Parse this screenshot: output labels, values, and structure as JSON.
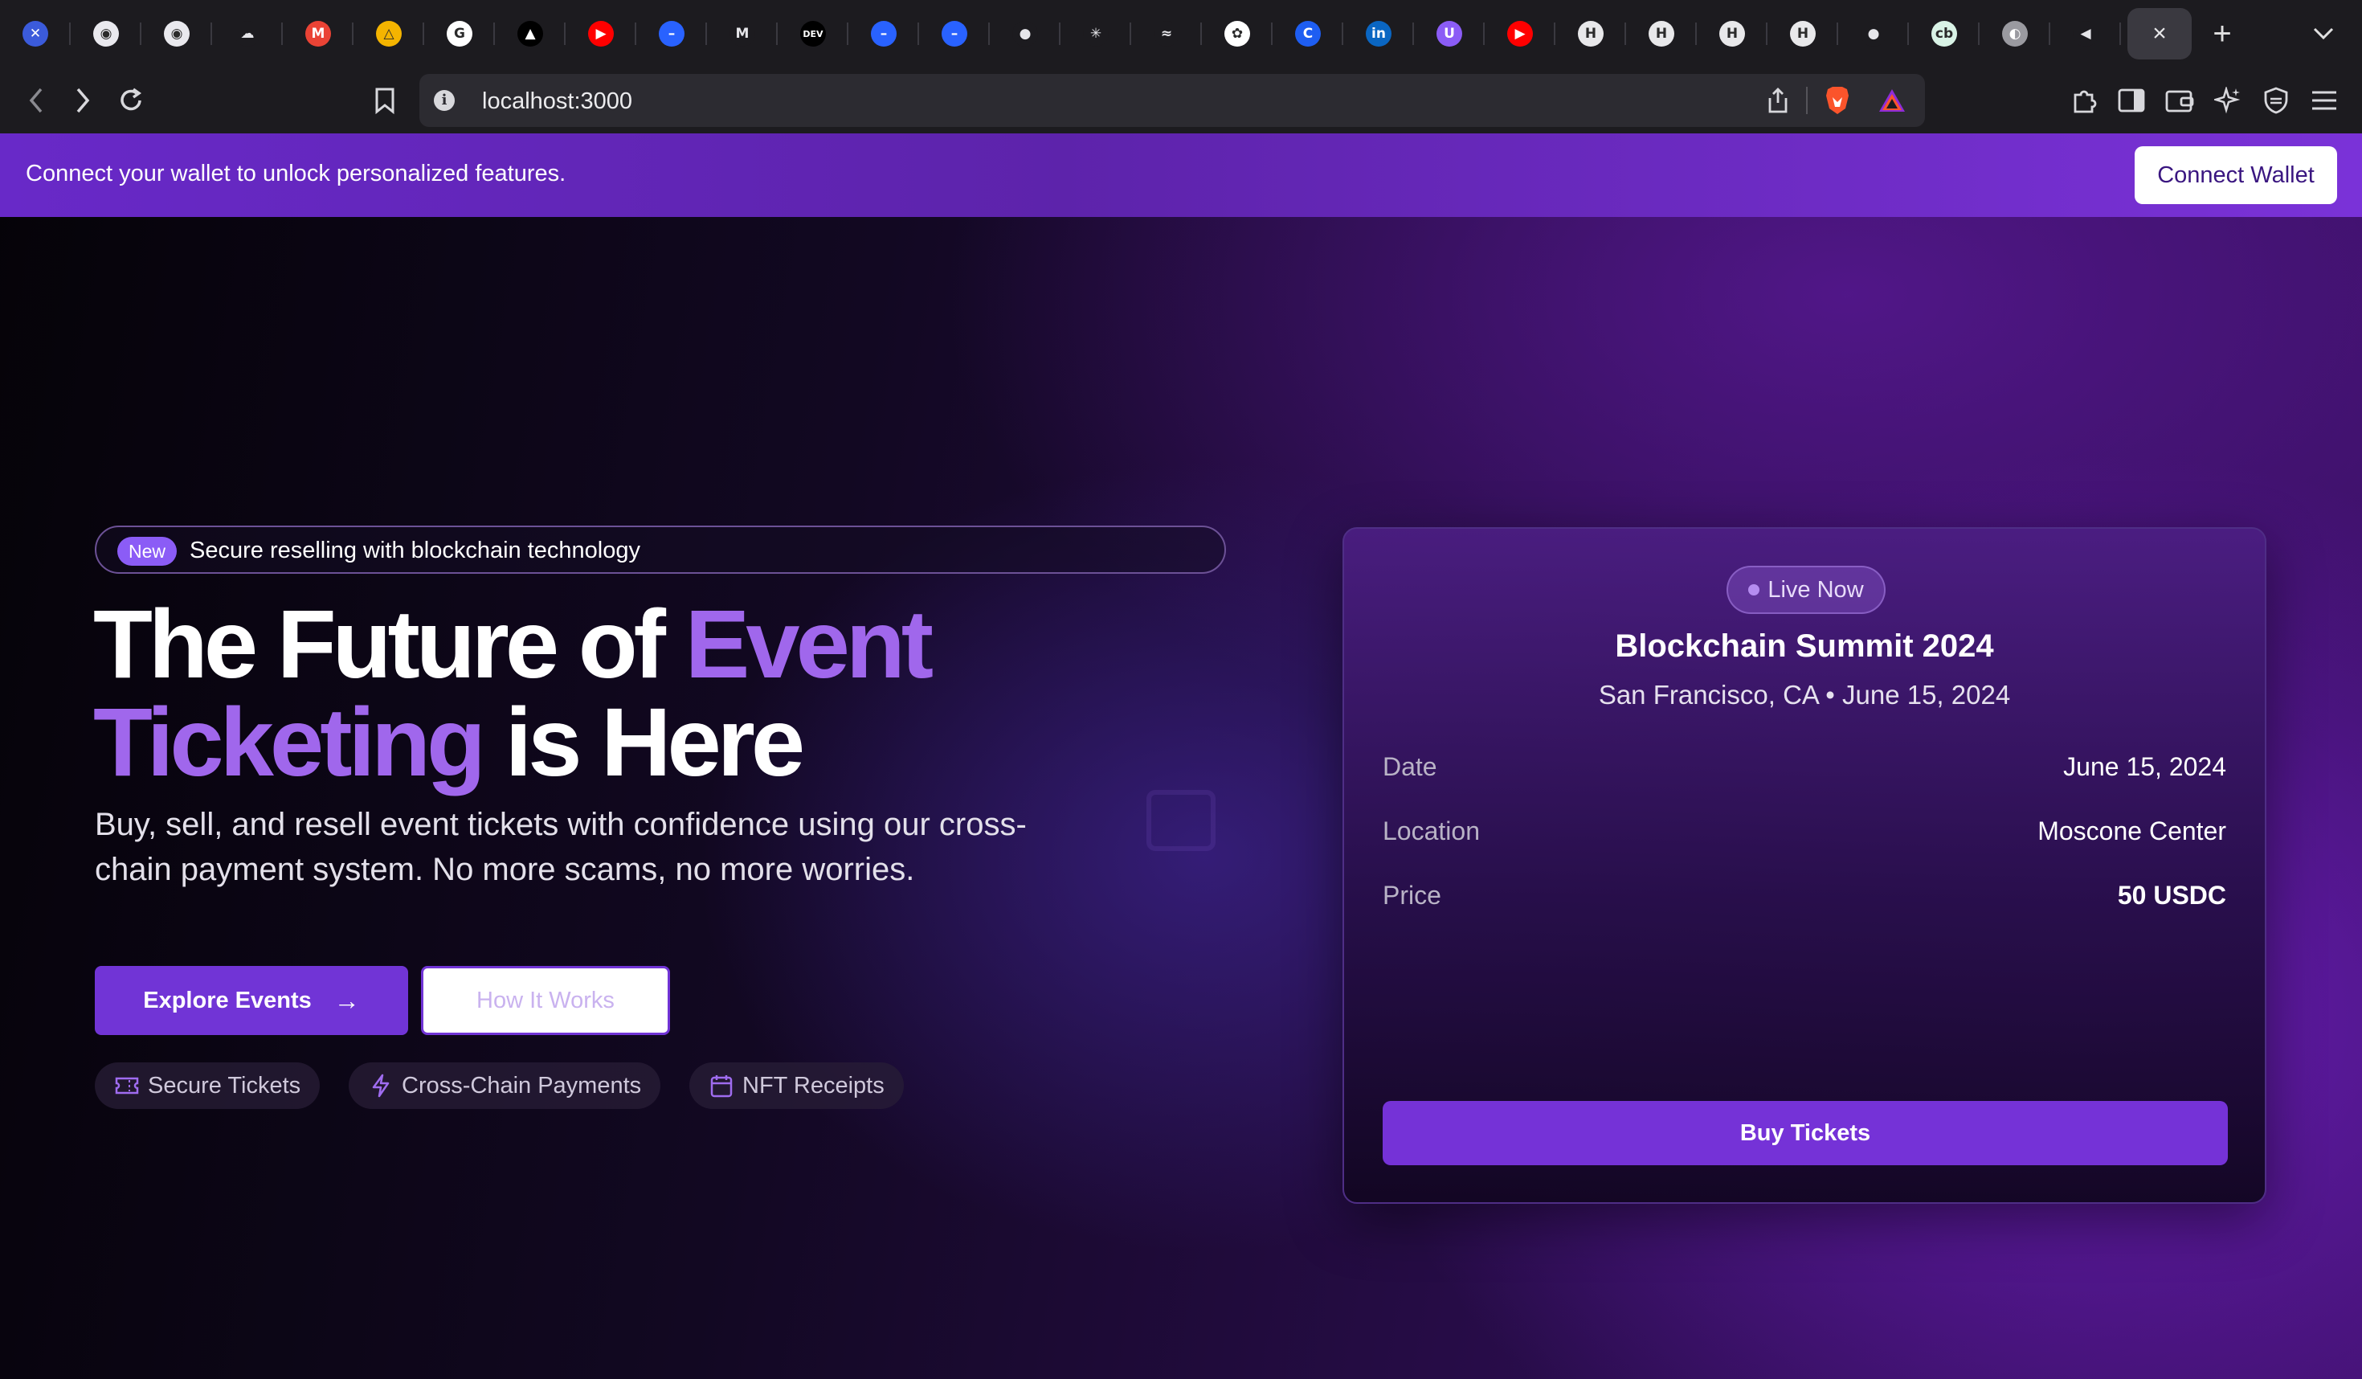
{
  "browser": {
    "tabs": [
      {
        "icon": "app-x-icon",
        "glyph": "✕",
        "color": "#3b5bdb"
      },
      {
        "icon": "circle-face-icon",
        "glyph": "◉",
        "color": "#e9e9ee"
      },
      {
        "icon": "circle-face-icon",
        "glyph": "◉",
        "color": "#e9e9ee"
      },
      {
        "icon": "cloud-icon",
        "glyph": "☁",
        "color": "#1c1b1f"
      },
      {
        "icon": "gmail-icon",
        "glyph": "M",
        "color": "#ea4335"
      },
      {
        "icon": "google-drive-icon",
        "glyph": "△",
        "color": "#f4b400"
      },
      {
        "icon": "google-icon",
        "glyph": "G",
        "color": "#ffffff"
      },
      {
        "icon": "triangle-icon",
        "glyph": "▲",
        "color": "#000000"
      },
      {
        "icon": "youtube-icon",
        "glyph": "▶",
        "color": "#ff0000"
      },
      {
        "icon": "blue-circle-icon",
        "glyph": "–",
        "color": "#2962ff"
      },
      {
        "icon": "mui-icon",
        "glyph": "M",
        "color": "#1c1b1f"
      },
      {
        "icon": "dev-icon",
        "glyph": "DEV",
        "color": "#000000"
      },
      {
        "icon": "blue-circle-icon",
        "glyph": "–",
        "color": "#2962ff"
      },
      {
        "icon": "blue-circle-icon",
        "glyph": "–",
        "color": "#2962ff"
      },
      {
        "icon": "github-icon",
        "glyph": "●",
        "color": "#1c1b1f"
      },
      {
        "icon": "asterisk-icon",
        "glyph": "✳",
        "color": "#1c1b1f"
      },
      {
        "icon": "tailwind-icon",
        "glyph": "≈",
        "color": "#1c1b1f"
      },
      {
        "icon": "openai-icon",
        "glyph": "✿",
        "color": "#ffffff"
      },
      {
        "icon": "c-icon",
        "glyph": "C",
        "color": "#1e5ef2"
      },
      {
        "icon": "linkedin-icon",
        "glyph": "in",
        "color": "#0a66c2"
      },
      {
        "icon": "u-icon",
        "glyph": "U",
        "color": "#8b5cf6"
      },
      {
        "icon": "youtube-icon",
        "glyph": "▶",
        "color": "#ff0000"
      },
      {
        "icon": "h-doc-icon",
        "glyph": "H",
        "color": "#e8e8ea"
      },
      {
        "icon": "h-doc-icon",
        "glyph": "H",
        "color": "#e8e8ea"
      },
      {
        "icon": "h-doc-icon",
        "glyph": "H",
        "color": "#e8e8ea"
      },
      {
        "icon": "h-doc-icon",
        "glyph": "H",
        "color": "#e8e8ea"
      },
      {
        "icon": "github-icon",
        "glyph": "●",
        "color": "#1c1b1f"
      },
      {
        "icon": "cb-icon",
        "glyph": "cb",
        "color": "#d9f3e6"
      },
      {
        "icon": "globe-icon",
        "glyph": "◐",
        "color": "#9a9aa0"
      },
      {
        "icon": "vscode-icon",
        "glyph": "◀",
        "color": "#1c1b1f"
      }
    ],
    "active_tab_close": "×",
    "new_tab": "+",
    "url": "localhost:3000"
  },
  "banner": {
    "text": "Connect your wallet to unlock personalized features.",
    "button": "Connect Wallet"
  },
  "hero": {
    "badge": "New",
    "badge_text": "Secure reselling with blockchain technology",
    "title_part1": "The Future of ",
    "title_accent": "Event Ticketing",
    "title_part2": " is Here",
    "subtitle": "Buy, sell, and resell event tickets with confidence using our cross-chain payment system. No more scams, no more worries.",
    "primary_button": "Explore Events",
    "secondary_button": "How It Works",
    "features": [
      "Secure Tickets",
      "Cross-Chain Payments",
      "NFT Receipts"
    ]
  },
  "event_card": {
    "status": "Live Now",
    "title": "Blockchain Summit 2024",
    "subtitle": "San Francisco, CA • June 15, 2024",
    "rows": [
      {
        "label": "Date",
        "value": "June 15, 2024"
      },
      {
        "label": "Location",
        "value": "Moscone Center"
      },
      {
        "label": "Price",
        "value": "50 USDC"
      }
    ],
    "button": "Buy Tickets"
  },
  "colors": {
    "accent": "#a067ec",
    "primary_button": "#7134d6",
    "banner": "#6829c8"
  }
}
